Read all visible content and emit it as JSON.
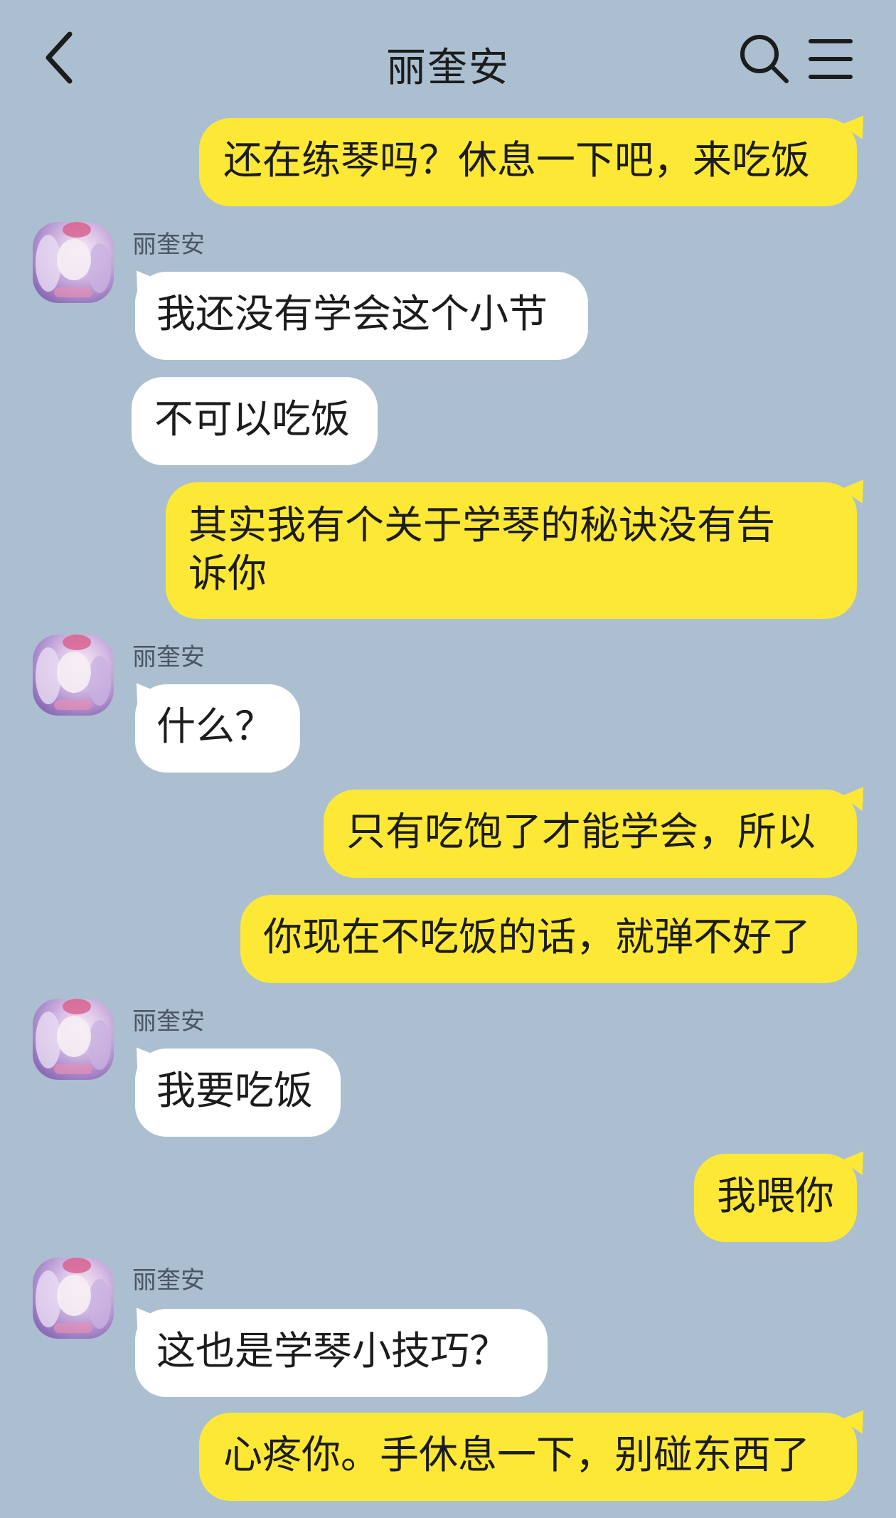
{
  "header": {
    "title": "丽奎安",
    "back_icon": "chevron-left-icon",
    "search_icon": "search-icon",
    "menu_icon": "menu-icon"
  },
  "colors": {
    "background": "#abbfd1",
    "my_bubble": "#fde935",
    "their_bubble": "#ffffff"
  },
  "messages": [
    {
      "sender": "me",
      "text": "还在练琴吗？休息一下吧，来吃饭"
    },
    {
      "sender": "them",
      "name": "丽奎安",
      "text": "我还没有学会这个小节"
    },
    {
      "sender": "them",
      "text": "不可以吃饭"
    },
    {
      "sender": "me",
      "text": "其实我有个关于学琴的秘诀没有告\n诉你"
    },
    {
      "sender": "them",
      "name": "丽奎安",
      "text": "什么？"
    },
    {
      "sender": "me",
      "text": "只有吃饱了才能学会，所以"
    },
    {
      "sender": "me",
      "text": "你现在不吃饭的话，就弹不好了"
    },
    {
      "sender": "them",
      "name": "丽奎安",
      "text": "我要吃饭"
    },
    {
      "sender": "me",
      "text": "我喂你"
    },
    {
      "sender": "them",
      "name": "丽奎安",
      "text": "这也是学琴小技巧？"
    },
    {
      "sender": "me",
      "text": "心疼你。手休息一下，别碰东西了"
    }
  ]
}
